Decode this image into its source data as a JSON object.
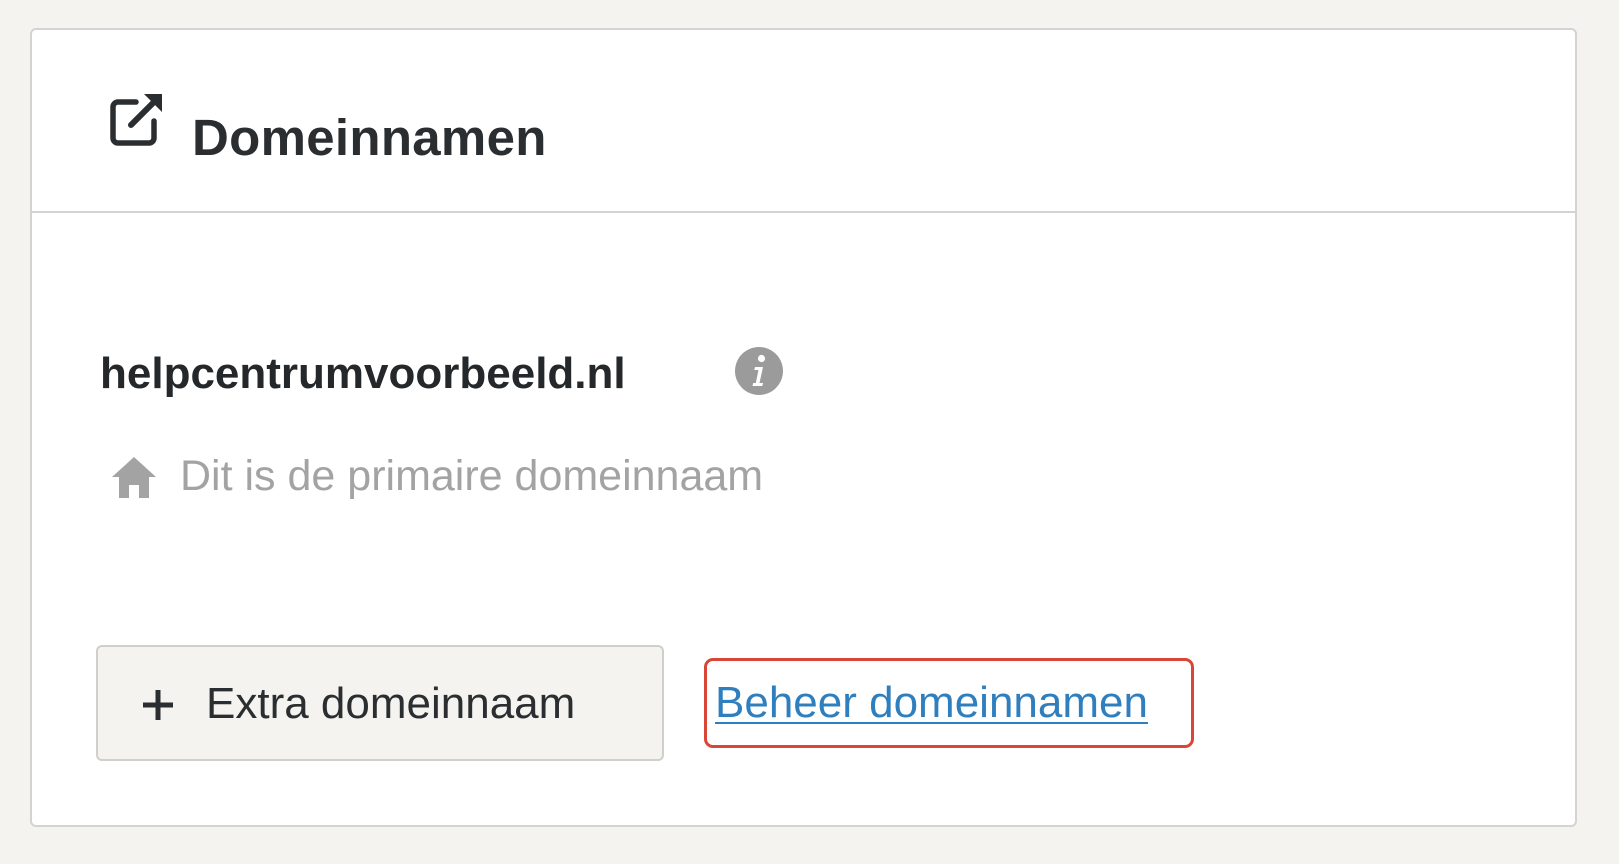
{
  "panel": {
    "title": "Domeinnamen",
    "title_icon": "external-link-icon"
  },
  "domain": {
    "name": "helpcentrumvoorbeeld.nl",
    "info_icon": "info-icon",
    "primary_icon": "home-icon",
    "primary_note": "Dit is de primaire domeinnaam"
  },
  "actions": {
    "add_icon": "plus-icon",
    "add_label": "Extra domeinnaam",
    "manage_label": "Beheer domeinnamen"
  },
  "colors": {
    "link": "#2f7fbf",
    "highlight": "#d94637",
    "muted": "#a3a3a3",
    "text": "#2b2e31"
  }
}
